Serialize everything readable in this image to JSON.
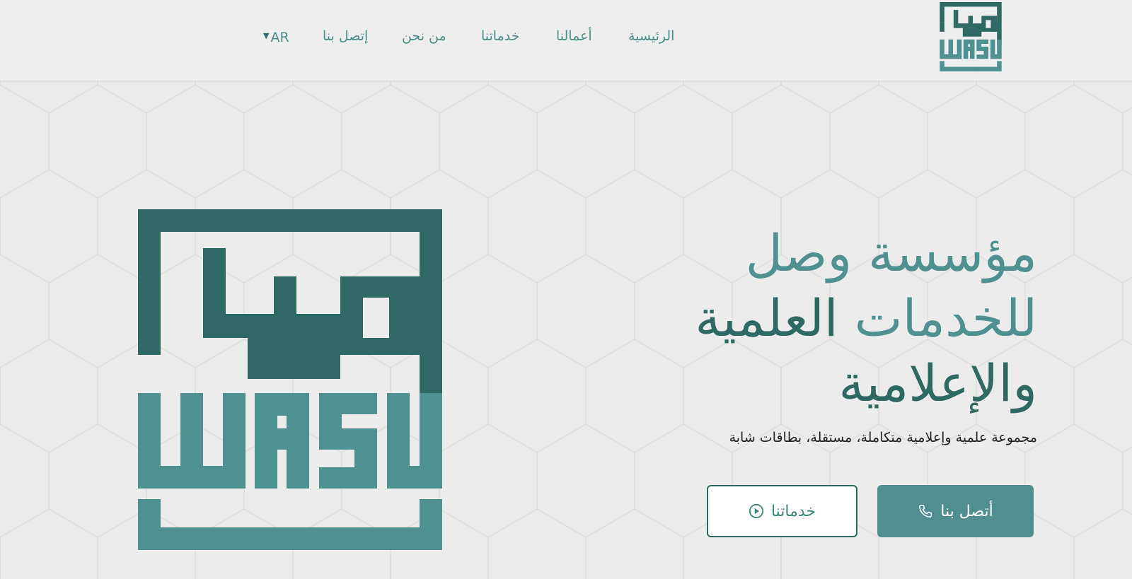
{
  "brand": {
    "logo_arabic": "وصل",
    "logo_latin": "WASL",
    "colors": {
      "dark": "#2f6963",
      "light": "#4f9090",
      "background": "#ececec"
    }
  },
  "nav": {
    "items": [
      {
        "label": "الرئيسية"
      },
      {
        "label": "أعمالنا"
      },
      {
        "label": "خدماتنا"
      },
      {
        "label": "من نحن"
      },
      {
        "label": "إتصل بنا"
      }
    ],
    "language": {
      "label": "AR",
      "icon": "chevron-down-icon"
    }
  },
  "hero": {
    "title_line1": "مؤسسة وصل",
    "title_line2_a": "للخدمات",
    "title_line2_b": "العلمية",
    "title_line3": "والإعلامية",
    "subtitle": "مجموعة علمية وإعلامية متكاملة، مستقلة، بطاقات شابة",
    "primary_button": {
      "label": "أتصل بنا",
      "icon": "phone-icon"
    },
    "secondary_button": {
      "label": "خدماتنا",
      "icon": "play-circle-icon"
    }
  }
}
